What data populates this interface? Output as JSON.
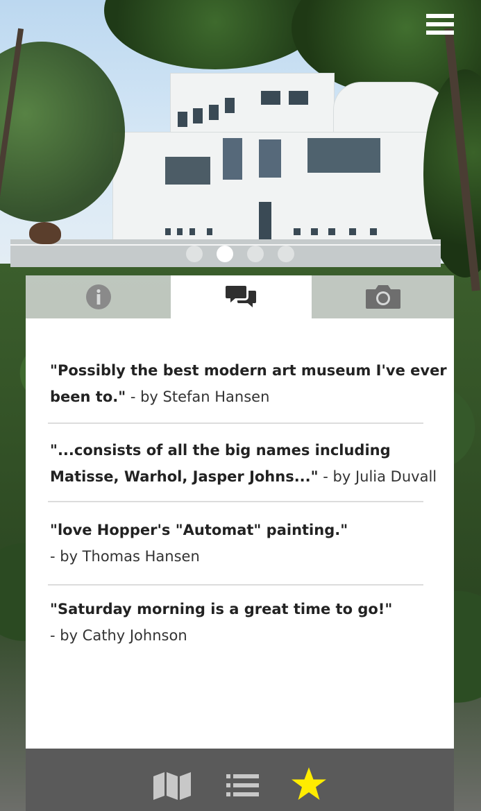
{
  "hero": {
    "pager": {
      "count": 4,
      "active_index": 1
    }
  },
  "tabs": [
    {
      "id": "info",
      "icon": "info-icon"
    },
    {
      "id": "reviews",
      "icon": "chat-bubbles-icon",
      "selected": true
    },
    {
      "id": "photos",
      "icon": "camera-icon"
    }
  ],
  "reviews": [
    {
      "quote": "\"Possibly the best modern art museum I've ever been to.\"",
      "author": " - by Stefan Hansen"
    },
    {
      "quote": "\"...consists of all the big names including Matisse, Warhol, Jasper Johns...\"",
      "author": " - by Julia Duvall"
    },
    {
      "quote": "\"love Hopper's \"Automat\" painting.\"",
      "author": "- by Thomas Hansen"
    },
    {
      "quote": "\"Saturday morning is a great time to go!\"",
      "author": "- by Cathy Johnson"
    }
  ],
  "bottom_nav": [
    {
      "icon": "map-icon"
    },
    {
      "icon": "list-icon"
    },
    {
      "icon": "star-icon",
      "active": true
    }
  ],
  "colors": {
    "active_star": "#ffec00",
    "nav_bar": "#5a5a5a",
    "icon_gray": "#c8c8c8",
    "tab_icon_dark": "#2f2f2f"
  }
}
